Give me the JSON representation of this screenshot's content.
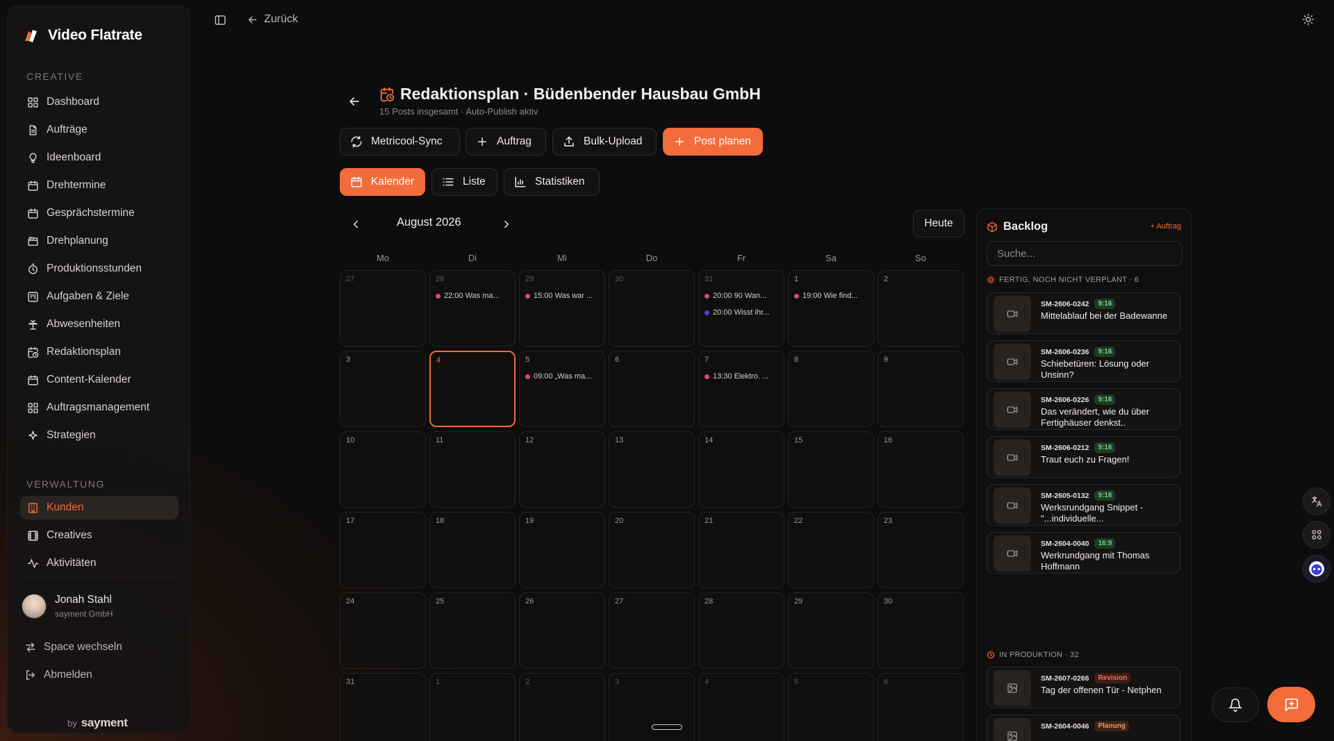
{
  "brand": {
    "name": "Video Flatrate"
  },
  "sidebar": {
    "creative_label": "CREATIVE",
    "creative_items": [
      {
        "label": "Dashboard",
        "icon": "grid-icon"
      },
      {
        "label": "Aufträge",
        "icon": "document-icon"
      },
      {
        "label": "Ideenboard",
        "icon": "lightbulb-icon"
      },
      {
        "label": "Drehtermine",
        "icon": "calendar-icon"
      },
      {
        "label": "Gesprächstermine",
        "icon": "calendar-icon"
      },
      {
        "label": "Drehplanung",
        "icon": "clapperboard-icon"
      },
      {
        "label": "Produktionsstunden",
        "icon": "timer-icon"
      },
      {
        "label": "Aufgaben & Ziele",
        "icon": "kanban-icon"
      },
      {
        "label": "Abwesenheiten",
        "icon": "palm-tree-icon"
      },
      {
        "label": "Redaktionsplan",
        "icon": "calendar-clock-icon"
      },
      {
        "label": "Content-Kalender",
        "icon": "calendar-icon"
      },
      {
        "label": "Auftragsmanagement",
        "icon": "grid-icon"
      },
      {
        "label": "Strategien",
        "icon": "sparkles-icon"
      }
    ],
    "admin_label": "VERWALTUNG",
    "admin_items": [
      {
        "label": "Kunden",
        "icon": "building-icon",
        "active": true
      },
      {
        "label": "Creatives",
        "icon": "film-icon"
      },
      {
        "label": "Aktivitäten",
        "icon": "activity-icon"
      }
    ],
    "user": {
      "name": "Jonah Stahl",
      "org": "sayment GmbH"
    },
    "switch_space": "Space wechseln",
    "logout": "Abmelden",
    "footer_by": "by",
    "footer_brand": "sayment"
  },
  "topbar": {
    "back_label": "Zurück"
  },
  "header": {
    "title": "Redaktionsplan · Büdenbender Hausbau GmbH",
    "subtitle": "15 Posts insgesamt · Auto-Publish aktiv"
  },
  "actions": {
    "sync": "Metricool-Sync",
    "order": "Auftrag",
    "bulk": "Bulk-Upload",
    "plan": "Post planen"
  },
  "views": {
    "calendar": "Kalender",
    "list": "Liste",
    "stats": "Statistiken"
  },
  "calendar": {
    "month": "August 2026",
    "today": "Heute",
    "weekdays": [
      "Mo",
      "Di",
      "Mi",
      "Do",
      "Fr",
      "Sa",
      "So"
    ],
    "days": [
      {
        "n": "27",
        "muted": true,
        "events": []
      },
      {
        "n": "28",
        "muted": true,
        "events": [
          {
            "text": "22:00 Was ma...",
            "color": "#d9467a"
          }
        ]
      },
      {
        "n": "29",
        "muted": true,
        "events": [
          {
            "text": "15:00 Was war ...",
            "color": "#d9467a"
          }
        ]
      },
      {
        "n": "30",
        "muted": true,
        "events": []
      },
      {
        "n": "31",
        "muted": true,
        "events": [
          {
            "text": "20:00 90 Wan...",
            "color": "#d9467a"
          },
          {
            "text": "20:00 Wisst ihr...",
            "color": "#5b3fd6"
          }
        ]
      },
      {
        "n": "1",
        "events": [
          {
            "text": "19:00 Wie find...",
            "color": "#d9467a"
          }
        ]
      },
      {
        "n": "2",
        "events": []
      },
      {
        "n": "3",
        "events": []
      },
      {
        "n": "4",
        "selected": true,
        "events": []
      },
      {
        "n": "5",
        "events": [
          {
            "text": "09:00 „Was ma...",
            "color": "#d9467a"
          }
        ]
      },
      {
        "n": "6",
        "events": []
      },
      {
        "n": "7",
        "events": [
          {
            "text": "13:30 Elektro. ...",
            "color": "#d9467a"
          }
        ]
      },
      {
        "n": "8",
        "events": []
      },
      {
        "n": "9",
        "events": []
      },
      {
        "n": "10",
        "events": []
      },
      {
        "n": "11",
        "events": []
      },
      {
        "n": "12",
        "events": []
      },
      {
        "n": "13",
        "events": []
      },
      {
        "n": "14",
        "events": []
      },
      {
        "n": "15",
        "events": []
      },
      {
        "n": "16",
        "events": []
      },
      {
        "n": "17",
        "events": []
      },
      {
        "n": "18",
        "events": []
      },
      {
        "n": "19",
        "events": []
      },
      {
        "n": "20",
        "events": []
      },
      {
        "n": "21",
        "events": []
      },
      {
        "n": "22",
        "events": []
      },
      {
        "n": "23",
        "events": []
      },
      {
        "n": "24",
        "events": []
      },
      {
        "n": "25",
        "events": []
      },
      {
        "n": "26",
        "events": []
      },
      {
        "n": "27",
        "events": []
      },
      {
        "n": "28",
        "events": []
      },
      {
        "n": "29",
        "events": []
      },
      {
        "n": "30",
        "events": []
      },
      {
        "n": "31",
        "events": []
      },
      {
        "n": "1",
        "muted": true,
        "events": []
      },
      {
        "n": "2",
        "muted": true,
        "events": []
      },
      {
        "n": "3",
        "muted": true,
        "events": []
      },
      {
        "n": "4",
        "muted": true,
        "events": []
      },
      {
        "n": "5",
        "muted": true,
        "events": []
      },
      {
        "n": "6",
        "muted": true,
        "events": []
      }
    ]
  },
  "backlog": {
    "title": "Backlog",
    "add": "+ Auftrag",
    "search_placeholder": "Suche...",
    "group_ready": "FERTIG, NOCH NICHT VERPLANT · 6",
    "group_production": "IN PRODUKTION · 32",
    "ready_items": [
      {
        "id": "SM-2606-0242",
        "badge": "9:16",
        "title": "Mittelablauf bei der Badewanne"
      },
      {
        "id": "SM-2606-0236",
        "badge": "9:16",
        "title": "Schiebetüren: Lösung oder Unsinn?"
      },
      {
        "id": "SM-2606-0226",
        "badge": "9:16",
        "title": "Das verändert, wie du über Fertighäuser denkst.."
      },
      {
        "id": "SM-2606-0212",
        "badge": "9:16",
        "title": "Traut euch zu Fragen!"
      },
      {
        "id": "SM-2605-0132",
        "badge": "9:16",
        "title": "Werksrundgang Snippet - \"...individuelle..."
      },
      {
        "id": "SM-2604-0040",
        "badge": "16:9",
        "title": "Werkrundgang mit Thomas Hoffmann"
      }
    ],
    "production_items": [
      {
        "id": "SM-2607-0266",
        "badge": "Revision",
        "title": "Tag der offenen Tür - Netphen"
      },
      {
        "id": "SM-2604-0046",
        "badge": "Planung",
        "title": ""
      }
    ]
  },
  "colors": {
    "accent": "#f26b3a",
    "event_pink": "#d9467a",
    "event_purple": "#5b3fd6"
  }
}
